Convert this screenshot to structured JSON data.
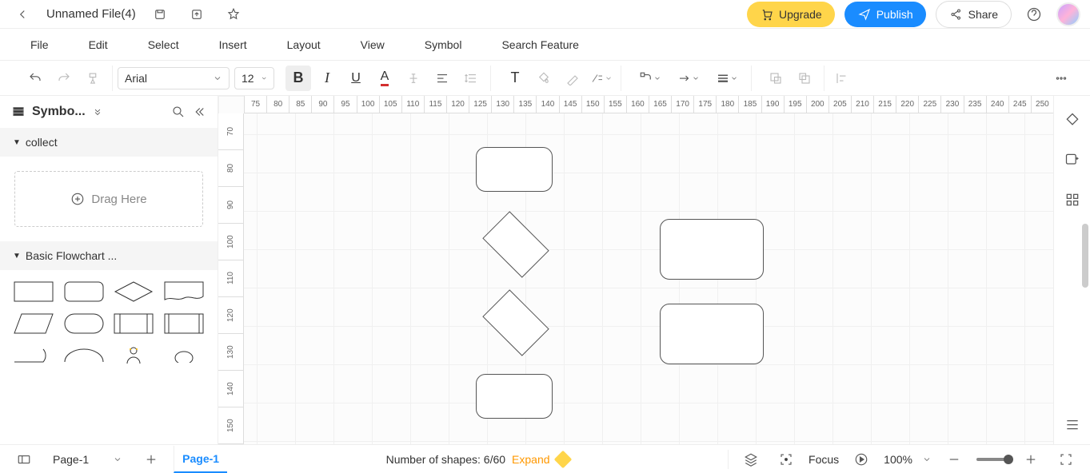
{
  "header": {
    "filename": "Unnamed File(4)",
    "upgrade": "Upgrade",
    "publish": "Publish",
    "share": "Share"
  },
  "menu": {
    "file": "File",
    "edit": "Edit",
    "select": "Select",
    "insert": "Insert",
    "layout": "Layout",
    "view": "View",
    "symbol": "Symbol",
    "search": "Search Feature"
  },
  "toolbar": {
    "font": "Arial",
    "size": "12"
  },
  "sidebar": {
    "title": "Symbo...",
    "collect": "collect",
    "drag": "Drag Here",
    "flowchart": "Basic Flowchart ..."
  },
  "ruler_h": [
    "75",
    "80",
    "85",
    "90",
    "95",
    "100",
    "105",
    "110",
    "115",
    "120",
    "125",
    "130",
    "135",
    "140",
    "145",
    "150",
    "155",
    "160",
    "165",
    "170",
    "175",
    "180",
    "185",
    "190",
    "195",
    "200",
    "205",
    "210",
    "215",
    "220",
    "225",
    "230",
    "235",
    "240",
    "245",
    "250"
  ],
  "ruler_v": [
    "70",
    "80",
    "90",
    "100",
    "110",
    "120",
    "130",
    "140",
    "150"
  ],
  "status": {
    "page_select": "Page-1",
    "page_tab": "Page-1",
    "shapes_label": "Number of shapes: 6/60",
    "expand": "Expand",
    "focus": "Focus",
    "zoom": "100%"
  }
}
